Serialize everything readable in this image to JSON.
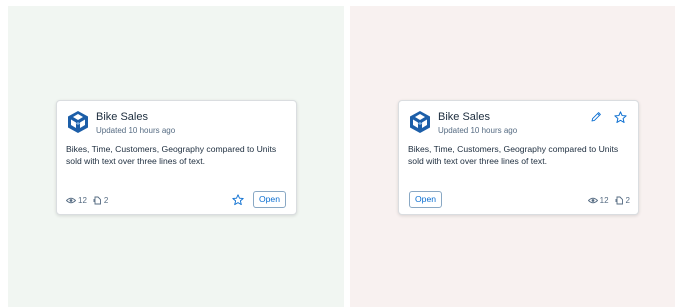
{
  "cards": [
    {
      "title": "Bike Sales",
      "subtitle": "Updated 10 hours ago",
      "description": "Bikes, Time, Customers, Geography compared to Units sold with text over three lines of text.",
      "views": "12",
      "shares": "2",
      "open_label": "Open",
      "icons": [
        "cube-logo-icon",
        "eye-icon",
        "share-icon",
        "star-icon"
      ]
    },
    {
      "title": "Bike Sales",
      "subtitle": "Updated 10 hours ago",
      "description": "Bikes, Time, Customers, Geography compared to Units sold with text over three lines of text.",
      "views": "12",
      "shares": "2",
      "open_label": "Open",
      "icons": [
        "cube-logo-icon",
        "pencil-icon",
        "star-icon",
        "eye-icon",
        "share-icon"
      ]
    }
  ],
  "colors": {
    "left_panel_bg": "#f1f6f2",
    "right_panel_bg": "#f8f1f0",
    "accent": "#0a6ed1",
    "logo_blue": "#1c5ea8"
  }
}
